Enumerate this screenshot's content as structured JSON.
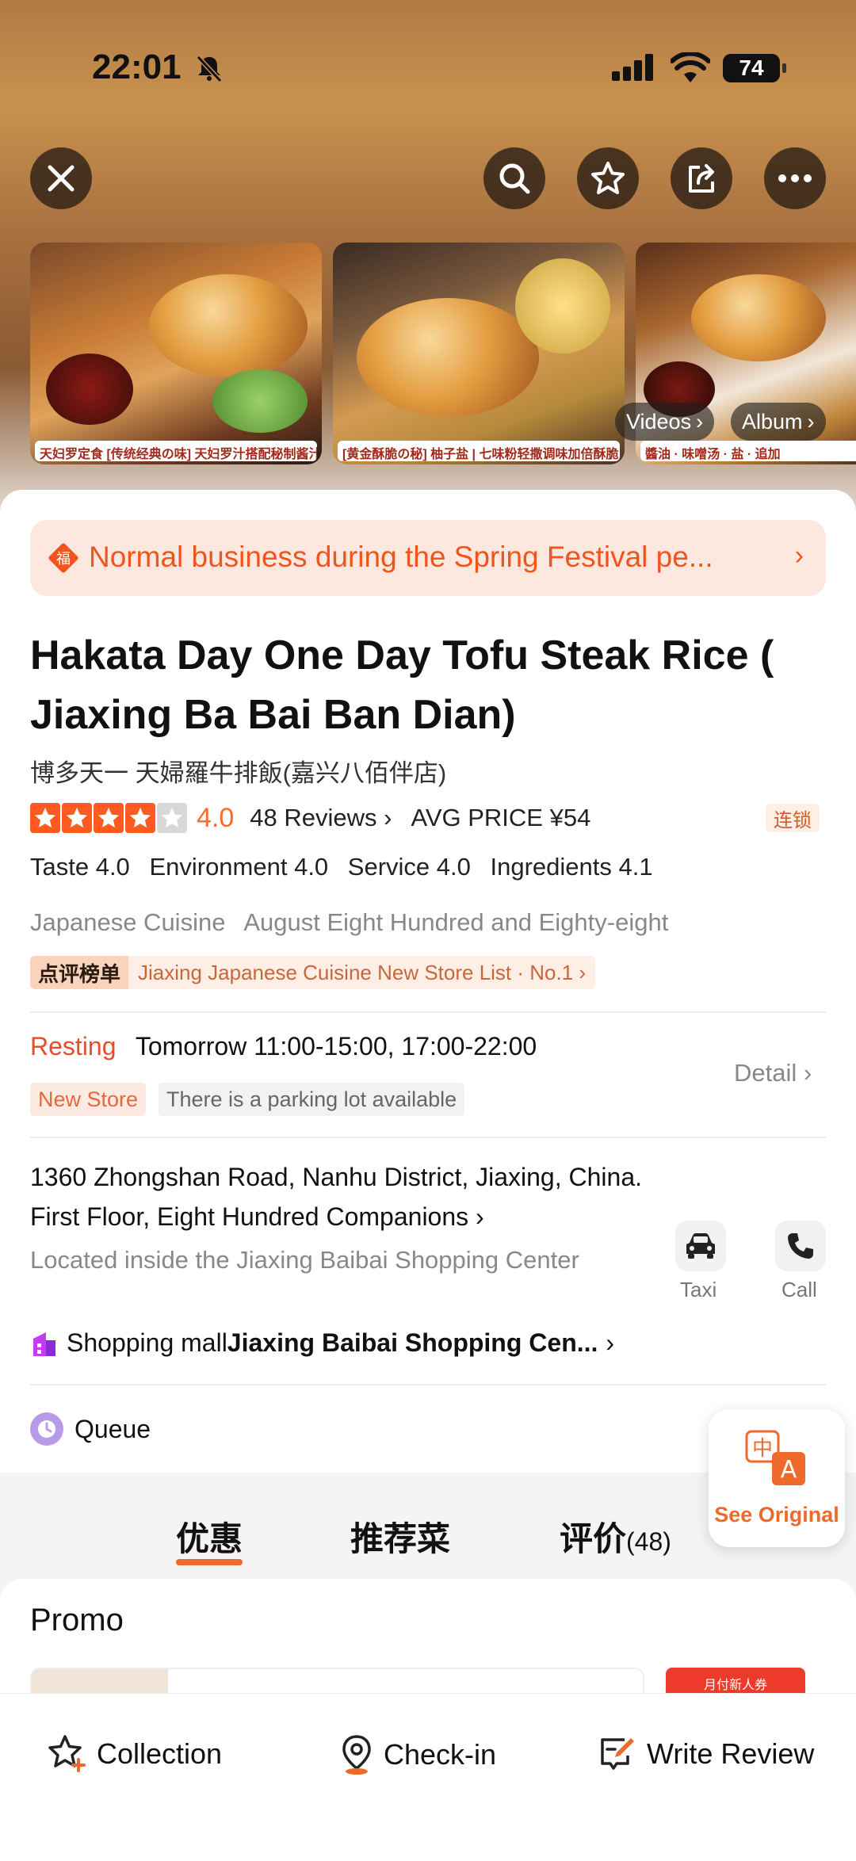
{
  "status": {
    "time": "22:01",
    "battery": "74"
  },
  "gallery": {
    "videos_label": "Videos",
    "album_label": "Album",
    "photo1_caption": "天妇罗定食 [传统经典の味] 天妇罗汁搭配秘制酱汁",
    "photo2_caption": "[黄金酥脆の秘] 柚子盐 | 七味粉轻撒调味加倍酥脆口感",
    "photo3_caption": "醬油 · 味噌汤 · 盐 · 追加"
  },
  "notice": {
    "text": "Normal business during the Spring Festival pe...",
    "icon_char": "福"
  },
  "shop": {
    "title": "Hakata Day One Day Tofu Steak Rice ( Jiaxing Ba Bai Ban Dian)",
    "subtitle": "博多天一 天婦羅牛排飯(嘉兴八佰伴店)",
    "rating": 4.0,
    "rating_text": "4.0",
    "reviews": "48 Reviews",
    "avg_price": "AVG PRICE ¥54",
    "chain_badge": "连锁",
    "subscores": {
      "taste": "Taste 4.0",
      "environment": "Environment 4.0",
      "service": "Service 4.0",
      "ingredients": "Ingredients 4.1"
    },
    "cuisine": "Japanese Cuisine",
    "area": "August Eight Hundred and Eighty-eight",
    "rank_tag": "点评榜单",
    "rank_text": "Jiaxing Japanese Cuisine New Store List · No.1"
  },
  "hours": {
    "status": "Resting",
    "schedule": "Tomorrow 11:00-15:00, 17:00-22:00",
    "tag_new": "New Store",
    "tag_parking": "There is a parking lot available",
    "detail_label": "Detail"
  },
  "address": {
    "line": "1360 Zhongshan Road, Nanhu District, Jiaxing, China. First Floor, Eight Hundred Companions",
    "located": "Located inside the Jiaxing Baibai Shopping Center",
    "mall_prefix": "Shopping mall",
    "mall_name": "Jiaxing Baibai Shopping Cen...",
    "taxi_label": "Taxi",
    "call_label": "Call"
  },
  "queue": {
    "label": "Queue"
  },
  "see_original": {
    "label": "See Original",
    "glyph_zh": "中",
    "glyph_a": "A"
  },
  "tabs": [
    {
      "label": "优惠"
    },
    {
      "label": "推荐菜"
    },
    {
      "label": "评价",
      "count": "(48)"
    }
  ],
  "promo": {
    "title": "Promo",
    "coupon_tag": "月付新人券"
  },
  "bottom": {
    "collection": "Collection",
    "checkin": "Check-in",
    "review": "Write Review"
  },
  "colors": {
    "accent": "#f06a2a",
    "rating": "#ff6a2a",
    "resting": "#ea4b2b"
  }
}
